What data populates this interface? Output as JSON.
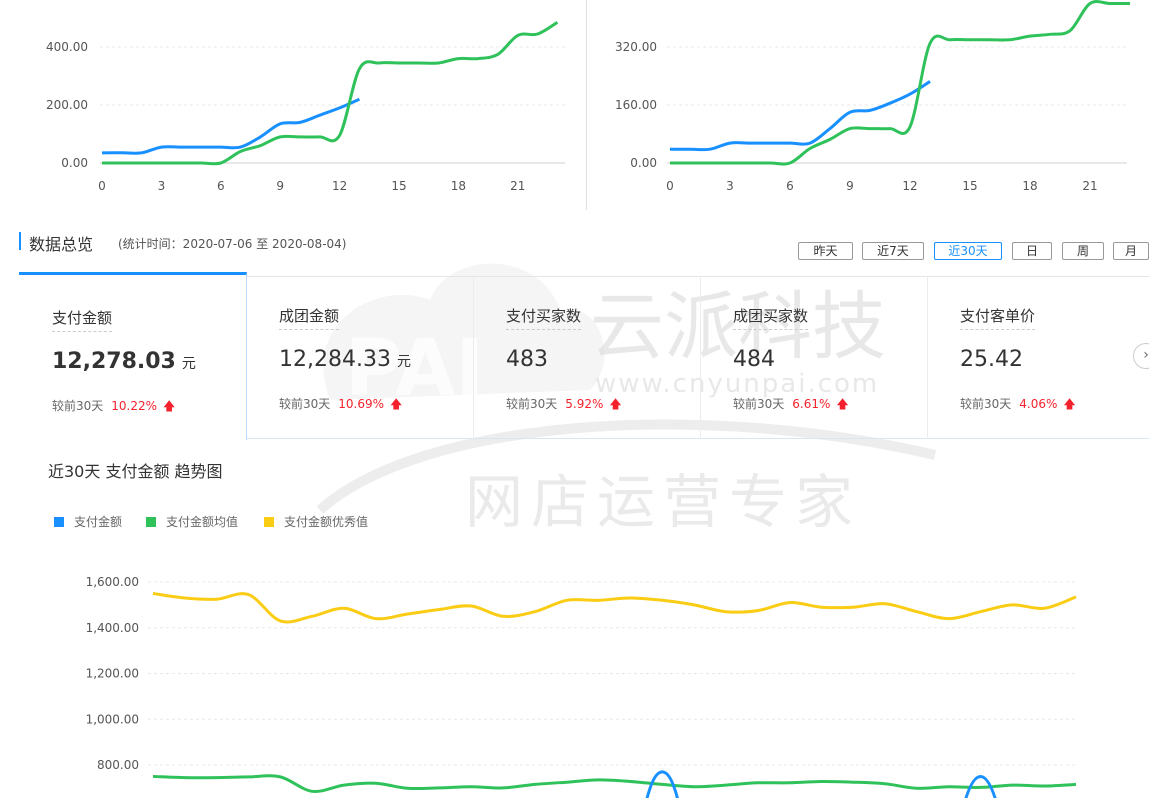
{
  "top_charts": {
    "left": {
      "y_ticks": [
        "400.00",
        "200.00",
        "0.00"
      ],
      "x_ticks": [
        "0",
        "3",
        "6",
        "9",
        "12",
        "15",
        "18",
        "21"
      ]
    },
    "right": {
      "y_ticks": [
        "320.00",
        "160.00",
        "0.00"
      ],
      "x_ticks": [
        "0",
        "3",
        "6",
        "9",
        "12",
        "15",
        "18",
        "21"
      ]
    }
  },
  "overview": {
    "title": "数据总览",
    "subtitle": "(统计时间：2020-07-06 至 2020-08-04)",
    "ranges": [
      {
        "label": "昨天",
        "active": false
      },
      {
        "label": "近7天",
        "active": false
      },
      {
        "label": "近30天",
        "active": true
      },
      {
        "label": "日",
        "active": false
      },
      {
        "label": "周",
        "active": false
      },
      {
        "label": "月",
        "active": false
      }
    ],
    "cards": [
      {
        "label": "支付金额",
        "value": "12,278.03",
        "unit": "元",
        "compare_label": "较前30天",
        "change": "10.22%",
        "selected": true
      },
      {
        "label": "成团金额",
        "value": "12,284.33",
        "unit": "元",
        "compare_label": "较前30天",
        "change": "10.69%",
        "selected": false
      },
      {
        "label": "支付买家数",
        "value": "483",
        "unit": "",
        "compare_label": "较前30天",
        "change": "5.92%",
        "selected": false
      },
      {
        "label": "成团买家数",
        "value": "484",
        "unit": "",
        "compare_label": "较前30天",
        "change": "6.61%",
        "selected": false
      },
      {
        "label": "支付客单价",
        "value": "25.42",
        "unit": "",
        "compare_label": "较前30天",
        "change": "4.06%",
        "selected": false
      }
    ],
    "up_arrow": "up-arrow-icon",
    "next_icon": "chevron-right-icon"
  },
  "trend": {
    "title": "近30天 支付金额 趋势图",
    "legend": [
      {
        "name": "支付金额",
        "color": "#1890ff"
      },
      {
        "name": "支付金额均值",
        "color": "#2fc25b"
      },
      {
        "name": "支付金额优秀值",
        "color": "#facc14"
      }
    ],
    "y_ticks": [
      "1,600.00",
      "1,400.00",
      "1,200.00",
      "1,000.00",
      "800.00"
    ]
  },
  "watermark": {
    "logo": "PAI",
    "brand": "云派科技",
    "url": "www.cnyunpai.com",
    "slogan": "网店运营专家"
  },
  "colors": {
    "blue": "#1890ff",
    "green": "#2fc25b",
    "yellow": "#facc14",
    "red": "#f5222d"
  },
  "chart_data": [
    {
      "type": "line",
      "x": [
        0,
        1,
        2,
        3,
        4,
        5,
        6,
        7,
        8,
        9,
        10,
        11,
        12,
        13,
        14,
        15,
        16,
        17,
        18,
        19,
        20,
        21,
        22,
        23
      ],
      "series": [
        {
          "values": [
            35,
            35,
            35,
            55,
            55,
            55,
            55,
            55,
            90,
            135,
            140,
            165,
            190,
            220
          ]
        },
        {
          "values": [
            0,
            0,
            0,
            0,
            0,
            0,
            0,
            40,
            60,
            90,
            90,
            90,
            95,
            325,
            345,
            345,
            345,
            345,
            360,
            360,
            375,
            440,
            445,
            485
          ]
        }
      ],
      "ylim": [
        0,
        480
      ]
    },
    {
      "type": "line",
      "x": [
        0,
        1,
        2,
        3,
        4,
        5,
        6,
        7,
        8,
        9,
        10,
        11,
        12,
        13,
        14,
        15,
        16,
        17,
        18,
        19,
        20,
        21,
        22,
        23
      ],
      "series": [
        {
          "values": [
            38,
            38,
            38,
            55,
            55,
            55,
            55,
            55,
            95,
            140,
            145,
            165,
            190,
            225
          ]
        },
        {
          "values": [
            0,
            0,
            0,
            0,
            0,
            0,
            0,
            40,
            65,
            95,
            95,
            95,
            100,
            330,
            340,
            340,
            340,
            340,
            350,
            355,
            365,
            440,
            440,
            440
          ]
        }
      ],
      "ylim": [
        0,
        400
      ]
    },
    {
      "type": "line",
      "x": [
        1,
        2,
        3,
        4,
        5,
        6,
        7,
        8,
        9,
        10,
        11,
        12,
        13,
        14,
        15,
        16,
        17,
        18,
        19,
        20,
        21,
        22,
        23,
        24,
        25,
        26,
        27,
        28,
        29,
        30
      ],
      "series": [
        {
          "name": "支付金额均值",
          "values": [
            750,
            745,
            745,
            748,
            748,
            685,
            712,
            720,
            698,
            700,
            705,
            700,
            715,
            725,
            735,
            728,
            715,
            705,
            712,
            722,
            722,
            728,
            725,
            718,
            698,
            705,
            702,
            712,
            708,
            715
          ]
        },
        {
          "name": "支付金额优秀值",
          "values": [
            1550,
            1530,
            1525,
            1545,
            1430,
            1450,
            1485,
            1440,
            1460,
            1480,
            1495,
            1450,
            1470,
            1520,
            1520,
            1530,
            1520,
            1500,
            1470,
            1475,
            1510,
            1490,
            1490,
            1505,
            1470,
            1440,
            1470,
            1500,
            1485,
            1535
          ]
        },
        {
          "name": "支付金额",
          "values": [
            null,
            null,
            null,
            null,
            null,
            null,
            null,
            null,
            null,
            null,
            null,
            null,
            null,
            null,
            null,
            null,
            770,
            null,
            null,
            null,
            null,
            null,
            null,
            null,
            null,
            null,
            750,
            null,
            null,
            null
          ]
        }
      ],
      "ylim": [
        800,
        1600
      ]
    }
  ]
}
